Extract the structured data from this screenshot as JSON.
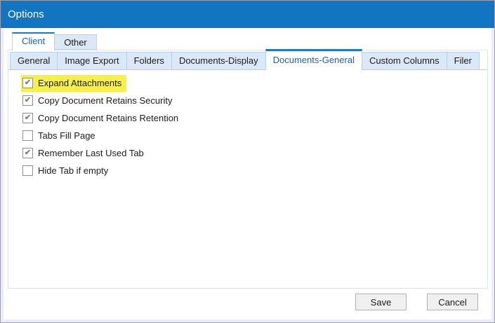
{
  "window": {
    "title": "Options"
  },
  "colors": {
    "titlebar": "#1175c2",
    "accent": "#1c76cf",
    "tab-selected-text": "#1563b2",
    "tab-bg": "#dbe8f7",
    "tab-border": "#b9cfe9",
    "page-border": "#d7e8f3",
    "highlight": "#f7f047",
    "check": "#7f7f7f"
  },
  "primary_tabs": [
    {
      "label": "Client",
      "selected": true
    },
    {
      "label": "Other",
      "selected": false
    }
  ],
  "secondary_tabs": [
    {
      "label": "General",
      "selected": false
    },
    {
      "label": "Image Export",
      "selected": false
    },
    {
      "label": "Folders",
      "selected": false
    },
    {
      "label": "Documents-Display",
      "selected": false
    },
    {
      "label": "Documents-General",
      "selected": true
    },
    {
      "label": "Custom Columns",
      "selected": false
    },
    {
      "label": "Filer",
      "selected": false
    }
  ],
  "options": [
    {
      "label": "Expand Attachments",
      "checked": true,
      "highlighted": true
    },
    {
      "label": "Copy Document Retains Security",
      "checked": true,
      "highlighted": false
    },
    {
      "label": "Copy Document Retains Retention",
      "checked": true,
      "highlighted": false
    },
    {
      "label": "Tabs Fill Page",
      "checked": false,
      "highlighted": false
    },
    {
      "label": "Remember Last Used Tab",
      "checked": true,
      "highlighted": false
    },
    {
      "label": "Hide Tab if empty",
      "checked": false,
      "highlighted": false
    }
  ],
  "footer": {
    "save_label": "Save",
    "cancel_label": "Cancel"
  },
  "icons": {
    "checkmark": "✔"
  }
}
